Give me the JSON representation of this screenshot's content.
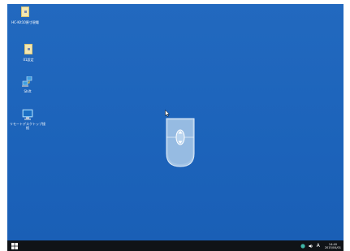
{
  "desktop": {
    "icons": [
      {
        "label": "HC-Kit10原寸現場",
        "icon": "file-icon"
      },
      {
        "label": "01設定",
        "icon": "file-icon"
      },
      {
        "label": "Shift",
        "icon": "network-icon"
      },
      {
        "label": "リモートデスクトップ接続",
        "icon": "remote-desktop-icon"
      }
    ],
    "background_color": "#1d63b8"
  },
  "overlay": {
    "icon": "scroll-indicator-icon"
  },
  "taskbar": {
    "start_icon": "windows-logo-icon",
    "tray": {
      "icons": [
        "network-tray-icon",
        "speaker-tray-icon"
      ],
      "language": "A",
      "time": "14:40",
      "date": "2015/04/01"
    }
  }
}
